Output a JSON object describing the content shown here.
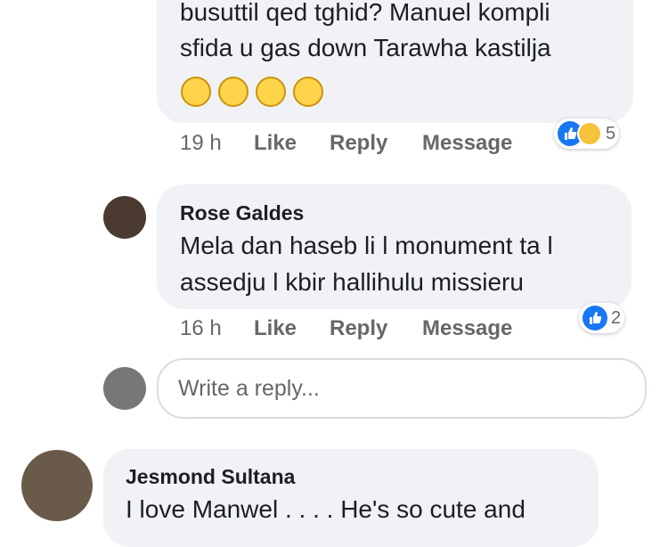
{
  "comments": [
    {
      "text_lines": [
        "busuttil qed tghid? Manuel kompli",
        "sfida u gas down Tarawha kastilja"
      ],
      "emojis": [
        "laughing-tears-emoji",
        "grinning-emoji",
        "smiling-emoji",
        "smiley-emoji"
      ],
      "time": "19 h",
      "actions": [
        "Like",
        "Reply",
        "Message"
      ],
      "reaction_count": "5",
      "reaction_icons": [
        "like-icon",
        "haha-icon"
      ]
    },
    {
      "author": "Rose Galdes",
      "text_lines": [
        "Mela dan haseb li l monument ta l",
        "assedju l kbir hallihulu missieru"
      ],
      "time": "16 h",
      "actions": [
        "Like",
        "Reply",
        "Message"
      ],
      "reaction_count": "2",
      "reaction_icons": [
        "like-icon"
      ]
    },
    {
      "author": "Jesmond Sultana",
      "text_lines": [
        "I love Manwel . . . . He's so cute and"
      ]
    }
  ],
  "reply_input": {
    "placeholder": "Write a reply..."
  },
  "colors": {
    "bubble": "#f0f2f5",
    "meta_text": "#65676b",
    "like_blue": "#1877f2"
  }
}
